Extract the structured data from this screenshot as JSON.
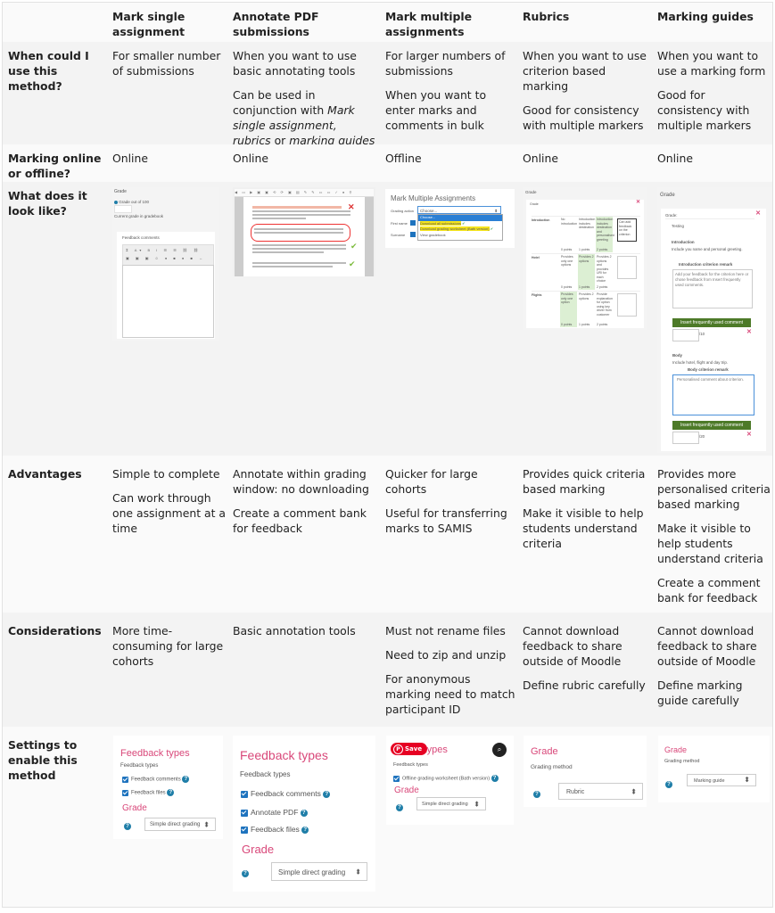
{
  "table": {
    "columns": [
      "",
      "Mark single assignment",
      "Annotate PDF submissions",
      "Mark multiple assignments",
      "Rubrics",
      "Marking guides"
    ],
    "rows": {
      "when": {
        "label": "When could I use this method?",
        "cells": [
          [
            "For smaller number of submissions"
          ],
          [
            "When you want to use basic annotating tools",
            "Can be used in conjunction with Mark single assignment, rubrics or marking guides"
          ],
          [
            "For larger numbers of submissions",
            "When you want to enter marks and comments in bulk"
          ],
          [
            "When you want to use criterion based marking",
            "Good for consistency with multiple markers"
          ],
          [
            "When you want to use a marking form",
            "Good for consistency with multiple markers"
          ]
        ],
        "annotate_conj": {
          "pre": "with ",
          "mark_single": "Mark single assignment,",
          "rubrics": "rubrics",
          "or": " or ",
          "guides": "marking guides",
          "intro": "Can be used in conjunction"
        }
      },
      "online": {
        "label": "Marking online or offline?",
        "cells": [
          "Online",
          "Online",
          "Offline",
          "Online",
          "Online"
        ]
      },
      "look": {
        "label": "What does it look like?"
      },
      "advantages": {
        "label": "Advantages",
        "cells": [
          [
            "Simple to complete",
            "Can work through one assignment at a time"
          ],
          [
            "Annotate within grading window: no downloading",
            "Create a comment bank for feedback"
          ],
          [
            "Quicker for large cohorts",
            "Useful for transferring marks to SAMIS"
          ],
          [
            "Provides quick criteria based marking",
            "Make it visible to help students understand criteria"
          ],
          [
            "Provides more personalised criteria based marking",
            "Make it visible to help students understand criteria",
            "Create a comment bank for feedback"
          ]
        ]
      },
      "considerations": {
        "label": "Considerations",
        "cells": [
          [
            "More time-consuming for large cohorts"
          ],
          [
            "Basic annotation tools"
          ],
          [
            "Must not rename files",
            "Need to zip and unzip",
            "For anonymous marking need to match participant ID"
          ],
          [
            "Cannot download feedback to share outside of Moodle",
            "Define rubric carefully"
          ],
          [
            "Cannot download feedback to share outside of Moodle",
            "Define marking guide carefully"
          ]
        ]
      },
      "settings": {
        "label": "Settings to enable this method"
      }
    }
  },
  "screens": {
    "single": {
      "title": "Grade",
      "grade_out_of": "Grade out of 100",
      "current": "Current grade in gradebook",
      "feedback_label": "Feedback comments"
    },
    "multiple": {
      "title": "Mark Multiple Assignments",
      "grading_action": "Grading action",
      "choose": "Choose...",
      "first_name": "First name",
      "surname": "Surname",
      "options": [
        "Choose...",
        "Download all submissions",
        "Download grading worksheet (Bath version)",
        "View gradebook"
      ]
    },
    "rubric": {
      "title": "Grade",
      "inner": "Grade",
      "criteria": [
        {
          "name": "Introduction",
          "levels": [
            "No introduction",
            "Introduction includes destination",
            "Introduction includes destination and personalised greeting"
          ],
          "points": [
            "0 points",
            "1 points",
            "2 points"
          ],
          "remark": "Can add feedback on the criterion",
          "selected": 2
        },
        {
          "name": "Hotel",
          "levels": [
            "Provides only one options",
            "Provides 2 options",
            "Provides 2 options and provides URl for each choice"
          ],
          "points": [
            "0 points",
            "1 points",
            "2 points"
          ],
          "remark": "",
          "selected": 1
        },
        {
          "name": "Flights",
          "levels": [
            "Provides only one option",
            "Provides 2 options",
            "Provide explanation for option using key driver from customer"
          ],
          "points": [
            "0 points",
            "1 points",
            "2 points"
          ],
          "remark": "",
          "selected": 0
        }
      ]
    },
    "guide": {
      "title": "Grade",
      "grade_label": "Grade:",
      "testing": "Testing",
      "intro_title": "Introduction",
      "intro_desc": "Include you name and personal greeting.",
      "intro_remark_label": "Introduction criterion remark",
      "intro_remark_placeholder": "Add your feedback for the criterion here or chose feedback from Insert frequently used comments.",
      "insert_btn": "Insert frequently used comment",
      "intro_max": "/10",
      "body_title": "Body",
      "body_desc": "Include hotel, flight and day trip.",
      "body_remark_label": "Body criterion remark",
      "body_remark_value": "Personalised comment about criterion.",
      "body_max": "/20"
    }
  },
  "settings": {
    "single": {
      "heading": "Feedback types",
      "sub": "Feedback types",
      "checks": [
        "Feedback comments",
        "Feedback files"
      ],
      "grade_heading": "Grade",
      "grade_select": "Simple direct grading"
    },
    "annotate": {
      "heading": "Feedback types",
      "sub": "Feedback types",
      "checks": [
        "Feedback comments",
        "Annotate PDF",
        "Feedback files"
      ],
      "grade_heading": "Grade",
      "grade_select": "Simple direct grading"
    },
    "multiple": {
      "heading": "k types",
      "save": "Save",
      "sub": "Feedback types",
      "checks": [
        "Offline grading worksheet (Bath version)"
      ],
      "grade_heading": "Grade",
      "grade_select": "Simple direct grading"
    },
    "rubric": {
      "heading": "Grade",
      "method_label": "Grading method",
      "select": "Rubric"
    },
    "guide": {
      "heading": "Grade",
      "method_label": "Grading method",
      "select": "Marking guide"
    }
  },
  "colors": {
    "pink": "#d9487a",
    "blue": "#1e73be",
    "green_btn": "#4d7a28",
    "pinterest_red": "#e60023"
  }
}
